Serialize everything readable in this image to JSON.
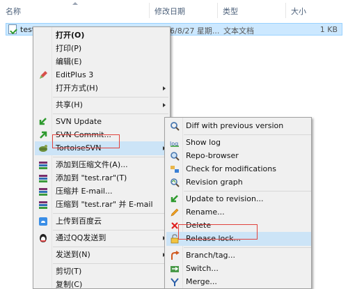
{
  "columns": {
    "name": "名称",
    "modified": "修改日期",
    "type": "类型",
    "size": "大小"
  },
  "file": {
    "name": "test.t...",
    "modified": "2016/8/27 星期...",
    "type": "文本文档",
    "size": "1 KB"
  },
  "context_menu": {
    "open": "打开(O)",
    "print": "打印(P)",
    "edit": "编辑(E)",
    "editplus": "EditPlus 3",
    "open_with": "打开方式(H)",
    "share": "共享(H)",
    "svn_update": "SVN Update",
    "svn_commit": "SVN Commit...",
    "tortoisesvn": "TortoiseSVN",
    "add_archive": "添加到压缩文件(A)...",
    "add_test_rar": "添加到 \"test.rar\"(T)",
    "compress_email": "压缩并 E-mail...",
    "compress_test_email": "压缩到 \"test.rar\" 并 E-mail",
    "upload_baidu": "上传到百度云",
    "send_qq": "通过QQ发送到",
    "send_to": "发送到(N)",
    "cut": "剪切(T)",
    "copy": "复制(C)"
  },
  "svn_submenu": {
    "diff_prev": "Diff with previous version",
    "show_log": "Show log",
    "repo_browser": "Repo-browser",
    "check_mods": "Check for modifications",
    "revision_graph": "Revision graph",
    "update_to_revision": "Update to revision...",
    "rename": "Rename...",
    "delete": "Delete",
    "release_lock": "Release lock...",
    "branch_tag": "Branch/tag...",
    "switch": "Switch...",
    "merge": "Merge..."
  },
  "colors": {
    "highlight": "#cce4f7",
    "selection": "#cce8ff",
    "annotation_box": "#e0413b"
  }
}
